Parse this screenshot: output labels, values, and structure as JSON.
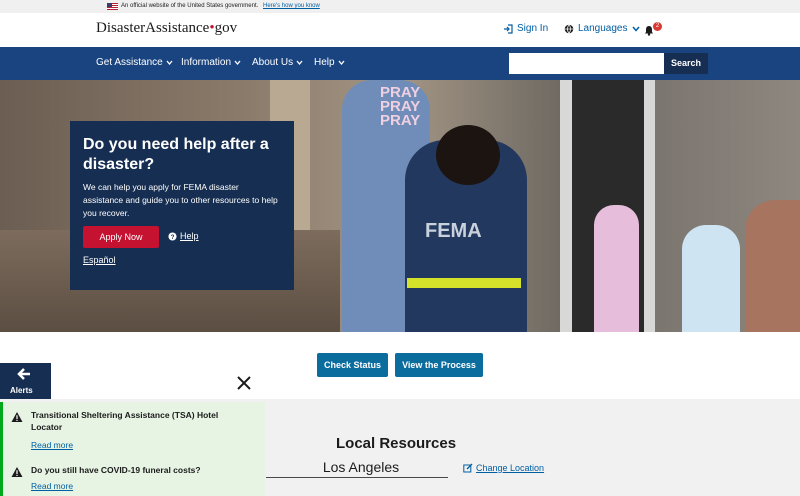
{
  "gov_banner": {
    "text": "An official website of the United States government.",
    "link": "Here's how you know"
  },
  "header": {
    "logo_main": "DisasterAssistance",
    "logo_dot": "•",
    "logo_tld": "gov",
    "sign_in": "Sign In",
    "languages": "Languages",
    "notifications_count": "2"
  },
  "nav": {
    "items": [
      {
        "label": "Get Assistance"
      },
      {
        "label": "Information"
      },
      {
        "label": "About Us"
      },
      {
        "label": "Help"
      }
    ],
    "search_placeholder": "",
    "search_button": "Search"
  },
  "hero": {
    "shirt_text": "PRAY PRAY PRAY",
    "vest_text": "FEMA",
    "title": "Do you need help after a disaster?",
    "description": "We can help you apply for FEMA disaster assistance and guide you to other resources to help you recover.",
    "apply_button": "Apply Now",
    "help_link": "Help",
    "spanish_link": "Español"
  },
  "actions": {
    "check_status": "Check Status",
    "view_process": "View the Process"
  },
  "local_resources": {
    "title": "Local Resources",
    "location": "Los Angeles",
    "change_location": "Change Location"
  },
  "alerts": {
    "tab_label": "Alerts",
    "items": [
      {
        "title": "Transitional Sheltering Assistance (TSA) Hotel Locator",
        "link": "Read more"
      },
      {
        "title": "Do you still have COVID-19 funeral costs?",
        "link": "Read more"
      }
    ]
  },
  "colors": {
    "nav_bg": "#1a4480",
    "card_bg": "#162e51",
    "apply_red": "#c41230",
    "action_blue": "#0b6c9e",
    "alert_green": "#00a91c"
  }
}
